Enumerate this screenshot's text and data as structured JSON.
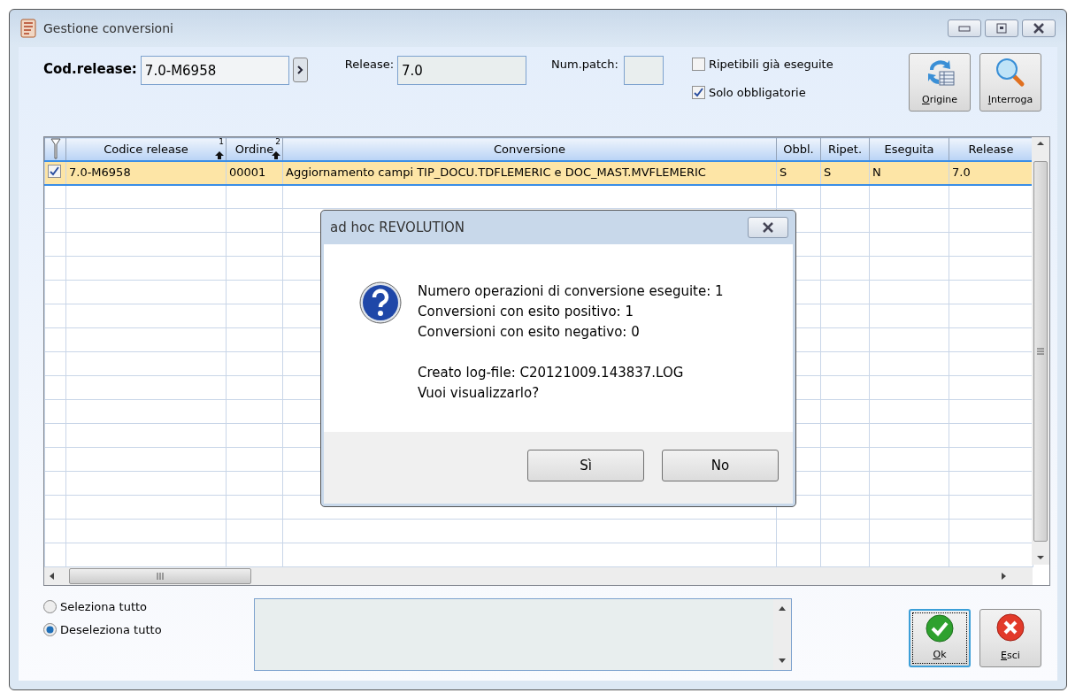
{
  "window": {
    "title": "Gestione conversioni"
  },
  "form": {
    "cod_release": {
      "label": "Cod.release:",
      "value": "7.0-M6958"
    },
    "release": {
      "label": "Release:",
      "value": "7.0"
    },
    "num_patch": {
      "label": "Num.patch:"
    },
    "checkboxes": [
      {
        "label": "Ripetibili già eseguite",
        "checked": false
      },
      {
        "label": "Solo obbligatorie",
        "checked": true
      }
    ],
    "tool_buttons": [
      {
        "kind": "origin",
        "label": "Origine"
      },
      {
        "kind": "search",
        "label": "Interroga"
      }
    ]
  },
  "table": {
    "columns": [
      {
        "label": "Codice release",
        "sort_order": "1"
      },
      {
        "label": "Ordine",
        "sort_order": "2"
      },
      {
        "label": "Conversione"
      },
      {
        "label": "Obbl."
      },
      {
        "label": "Ripet."
      },
      {
        "label": "Eseguita"
      },
      {
        "label": "Release"
      }
    ],
    "rows": [
      {
        "checked": true,
        "selected": true,
        "cells": [
          "7.0-M6958",
          "00001",
          "Aggiornamento campi TIP_DOCU.TDFLEMERIC e DOC_MAST.MVFLEMERIC",
          "S",
          "S",
          "N",
          "7.0"
        ]
      }
    ]
  },
  "radios": [
    {
      "label": "Seleziona tutto",
      "selected": false
    },
    {
      "label": "Deseleziona tutto",
      "selected": true
    }
  ],
  "bottom_buttons": [
    {
      "kind": "ok",
      "label": "Ok",
      "focused": true
    },
    {
      "kind": "exit",
      "label": "Esci",
      "focused": false
    }
  ],
  "dialog": {
    "title": "ad hoc REVOLUTION",
    "paragraphs": [
      {
        "lines": [
          "Numero operazioni di conversione eseguite: 1",
          "Conversioni con esito positivo: 1",
          "Conversioni con esito negativo: 0"
        ]
      },
      {
        "lines": [
          "Creato log-file: C20121009.143837.LOG",
          "Vuoi visualizzarlo?"
        ]
      }
    ],
    "buttons": [
      "Sì",
      "No"
    ]
  }
}
